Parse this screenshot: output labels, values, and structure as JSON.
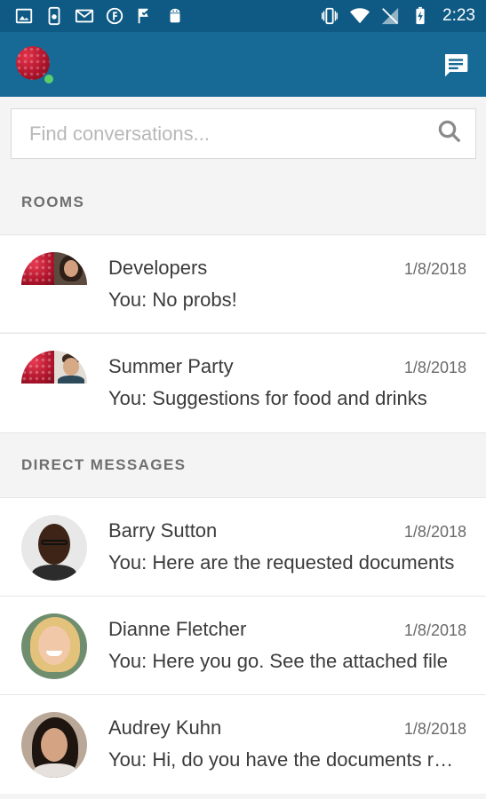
{
  "status_bar": {
    "time": "2:23",
    "left_icons": [
      "image-icon",
      "sim-icon",
      "gmail-icon",
      "circle-f-icon",
      "check-flag-icon",
      "android-icon"
    ],
    "right_icons": [
      "vibrate-icon",
      "wifi-icon",
      "no-signal-icon",
      "battery-charging-icon"
    ]
  },
  "app_bar": {
    "presence": "online",
    "new_chat_icon": "message-icon"
  },
  "search": {
    "placeholder": "Find conversations...",
    "value": ""
  },
  "sections": {
    "rooms_label": "ROOMS",
    "direct_label": "DIRECT MESSAGES"
  },
  "rooms": [
    {
      "name": "Developers",
      "date": "1/8/2018",
      "preview": "You: No probs!"
    },
    {
      "name": "Summer Party",
      "date": "1/8/2018",
      "preview": "You: Suggestions for food and drinks"
    }
  ],
  "direct_messages": [
    {
      "name": "Barry Sutton",
      "date": "1/8/2018",
      "preview": "You: Here are the requested documents"
    },
    {
      "name": "Dianne Fletcher",
      "date": "1/8/2018",
      "preview": "You: Here you go. See the attached file"
    },
    {
      "name": "Audrey Kuhn",
      "date": "1/8/2018",
      "preview": "You: Hi, do you have the documents ready"
    }
  ],
  "colors": {
    "status_bar": "#0e5a84",
    "app_bar": "#166a95",
    "online": "#5ccf6b"
  }
}
